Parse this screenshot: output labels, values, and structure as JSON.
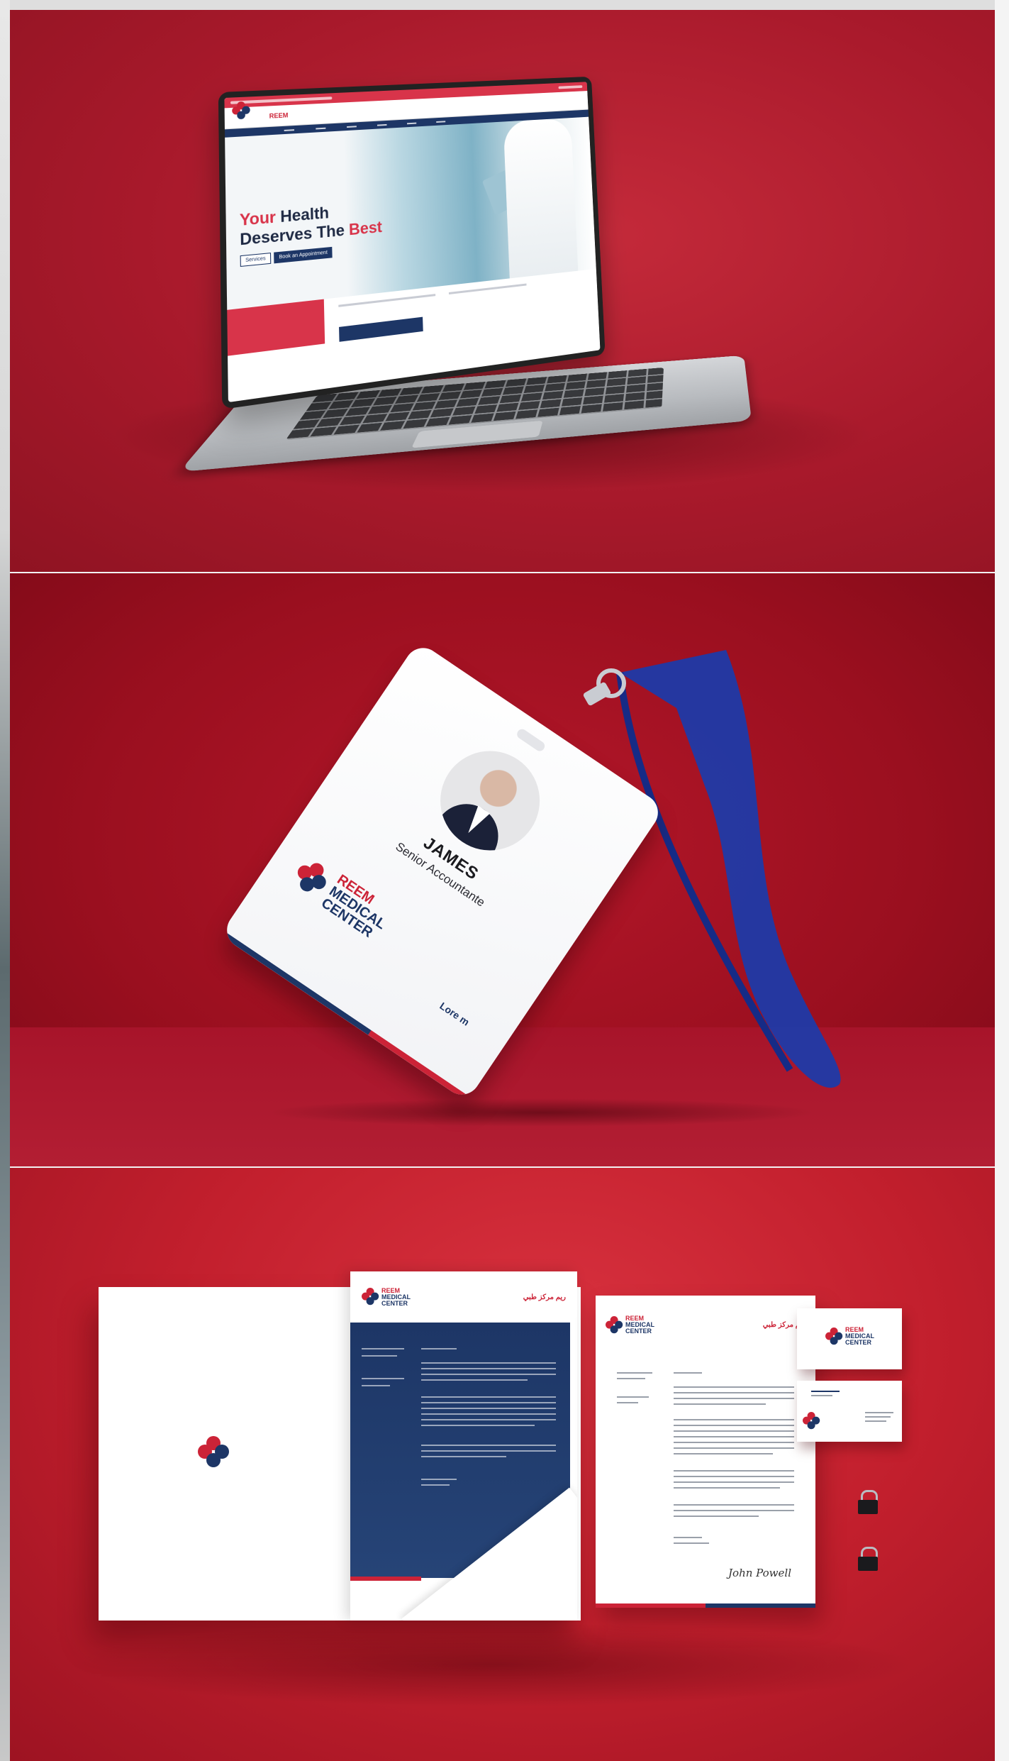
{
  "colors": {
    "brand_red": "#cc2337",
    "brand_navy": "#1d3666",
    "background_red": "#a8192b"
  },
  "laptop": {
    "hero": {
      "line1_accent": "Your",
      "line1_rest": " Health",
      "line2_rest": "Deserves The ",
      "line2_accent": "Best",
      "button_1": "Services",
      "button_2": "Book an Appointment"
    },
    "logo_text": "REEM"
  },
  "badge": {
    "name": "JAMES",
    "role": "Senior Accountante",
    "logo_lines": [
      "REEM",
      "MEDICAL",
      "CENTER"
    ],
    "signature": "Lore m"
  },
  "stationery": {
    "logo_lines": [
      "REEM",
      "MEDICAL",
      "CENTER"
    ],
    "arabic_name": "ريم مركز طبي",
    "signature": "John Powell"
  }
}
